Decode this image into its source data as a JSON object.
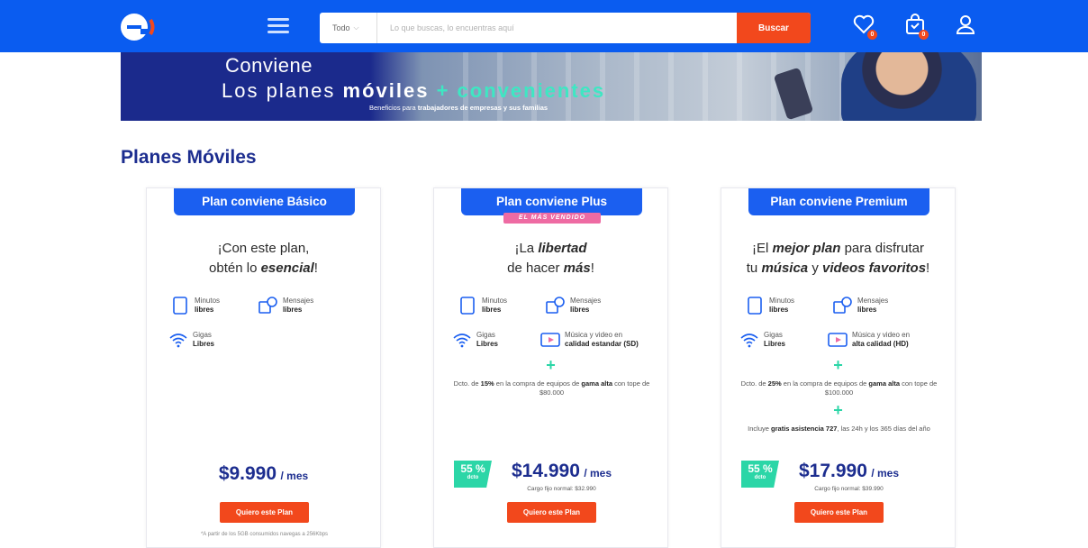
{
  "header": {
    "search_category": "Todo",
    "search_placeholder": "Lo que buscas, lo encuentras aquí",
    "search_button": "Buscar",
    "wishlist_count": "0",
    "cart_count": "0",
    "colors": {
      "bar": "#0a5cf0",
      "accent": "#f2481c"
    }
  },
  "banner": {
    "line1": "Conviene",
    "line2_a": "Los planes ",
    "line2_b": "móviles",
    "line2_plus": " + ",
    "line2_c": "convenientes",
    "line3_a": "Beneficios para ",
    "line3_b": "trabajadores de empresas y sus familias"
  },
  "section_title": "Planes Móviles",
  "plans": [
    {
      "title": "Plan conviene Básico",
      "tagline_1": "¡Con este plan,",
      "tagline_2a": "obtén lo ",
      "tagline_2b": "esencial",
      "tagline_2c": "!",
      "features": [
        {
          "icon": "phone-icon",
          "label": "Minutos",
          "value": "libres"
        },
        {
          "icon": "message-icon",
          "label": "Mensajes",
          "value": "libres"
        },
        {
          "icon": "wifi-icon",
          "label": "Gigas",
          "value": "Libres"
        }
      ],
      "price": "$9.990",
      "per": "/ mes",
      "cta": "Quiero este Plan",
      "footnote": "*A partir de los 5GB consumidos navegas a 256Kbps"
    },
    {
      "title": "Plan conviene Plus",
      "ribbon": "EL MÁS VENDIDO",
      "tagline_1a": "¡La ",
      "tagline_1b": "libertad",
      "tagline_2a": "de hacer ",
      "tagline_2b": "más",
      "tagline_2c": "!",
      "features": [
        {
          "icon": "phone-icon",
          "label": "Minutos",
          "value": "libres"
        },
        {
          "icon": "message-icon",
          "label": "Mensajes",
          "value": "libres"
        },
        {
          "icon": "wifi-icon",
          "label": "Gigas",
          "value": "Libres"
        },
        {
          "icon": "video-icon",
          "label": "Música y video en",
          "value": "calidad estandar (SD)"
        }
      ],
      "note_a": "Dcto. de ",
      "note_b": "15%",
      "note_c": " en la compra de equipos de ",
      "note_d": "gama alta",
      "note_e": " con tope de $80.000",
      "discount": "55 %",
      "discount_small": "dcto",
      "price": "$14.990",
      "per": "/ mes",
      "cargo": "Cargo fijo normal: $32.990",
      "cta": "Quiero este Plan"
    },
    {
      "title": "Plan conviene Premium",
      "tagline_1a": "¡El ",
      "tagline_1b": "mejor plan",
      "tagline_1c": " para disfrutar",
      "tagline_2a": "tu ",
      "tagline_2b": "música",
      "tagline_2c": " y ",
      "tagline_2d": "videos favoritos",
      "tagline_2e": "!",
      "features": [
        {
          "icon": "phone-icon",
          "label": "Minutos",
          "value": "libres"
        },
        {
          "icon": "message-icon",
          "label": "Mensajes",
          "value": "libres"
        },
        {
          "icon": "wifi-icon",
          "label": "Gigas",
          "value": "Libres"
        },
        {
          "icon": "video-icon",
          "label": "Música y video en",
          "value": "alta calidad (HD)"
        }
      ],
      "note_a": "Dcto. de ",
      "note_b": "25%",
      "note_c": " en la compra de equipos de ",
      "note_d": "gama alta",
      "note_e": " con tope de $100.000",
      "extra_a": "Incluye ",
      "extra_b": "gratis asistencia 727",
      "extra_c": ", las 24h y los 365 días del año",
      "discount": "55 %",
      "discount_small": "dcto",
      "price": "$17.990",
      "per": "/ mes",
      "cargo": "Cargo fijo normal: $39.990",
      "cta": "Quiero este Plan"
    }
  ]
}
